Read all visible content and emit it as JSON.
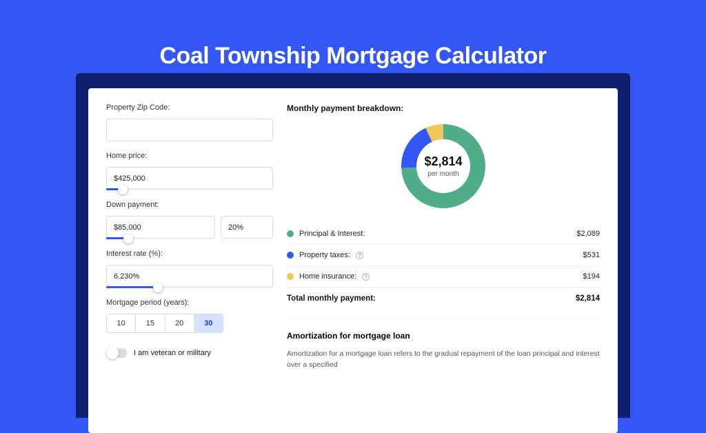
{
  "title": "Coal Township Mortgage Calculator",
  "form": {
    "zip_label": "Property Zip Code:",
    "zip_value": "",
    "home_price_label": "Home price:",
    "home_price_value": "$425,000",
    "down_payment_label": "Down payment:",
    "down_payment_value": "$85,000",
    "down_payment_pct": "20%",
    "interest_label": "Interest rate (%):",
    "interest_value": "6.230%",
    "period_label": "Mortgage period (years):",
    "period_options": [
      "10",
      "15",
      "20",
      "30"
    ],
    "period_selected": "30",
    "veteran_label": "I am veteran or military"
  },
  "breakdown": {
    "section_title": "Monthly payment breakdown:",
    "center_amount": "$2,814",
    "center_sub": "per month",
    "items": [
      {
        "label": "Principal & Interest:",
        "value": "$2,089",
        "color": "#4fae88"
      },
      {
        "label": "Property taxes:",
        "value": "$531",
        "color": "#3356f6",
        "info": true
      },
      {
        "label": "Home insurance:",
        "value": "$194",
        "color": "#f1c95a",
        "info": true
      }
    ],
    "total_label": "Total monthly payment:",
    "total_value": "$2,814"
  },
  "amort": {
    "title": "Amortization for mortgage loan",
    "text": "Amortization for a mortgage loan refers to the gradual repayment of the loan principal and interest over a specified"
  },
  "chart_data": {
    "type": "pie",
    "title": "Monthly payment breakdown",
    "series": [
      {
        "name": "Principal & Interest",
        "value": 2089,
        "color": "#4fae88"
      },
      {
        "name": "Property taxes",
        "value": 531,
        "color": "#3356f6"
      },
      {
        "name": "Home insurance",
        "value": 194,
        "color": "#f1c95a"
      }
    ],
    "total": 2814,
    "unit": "USD per month"
  }
}
